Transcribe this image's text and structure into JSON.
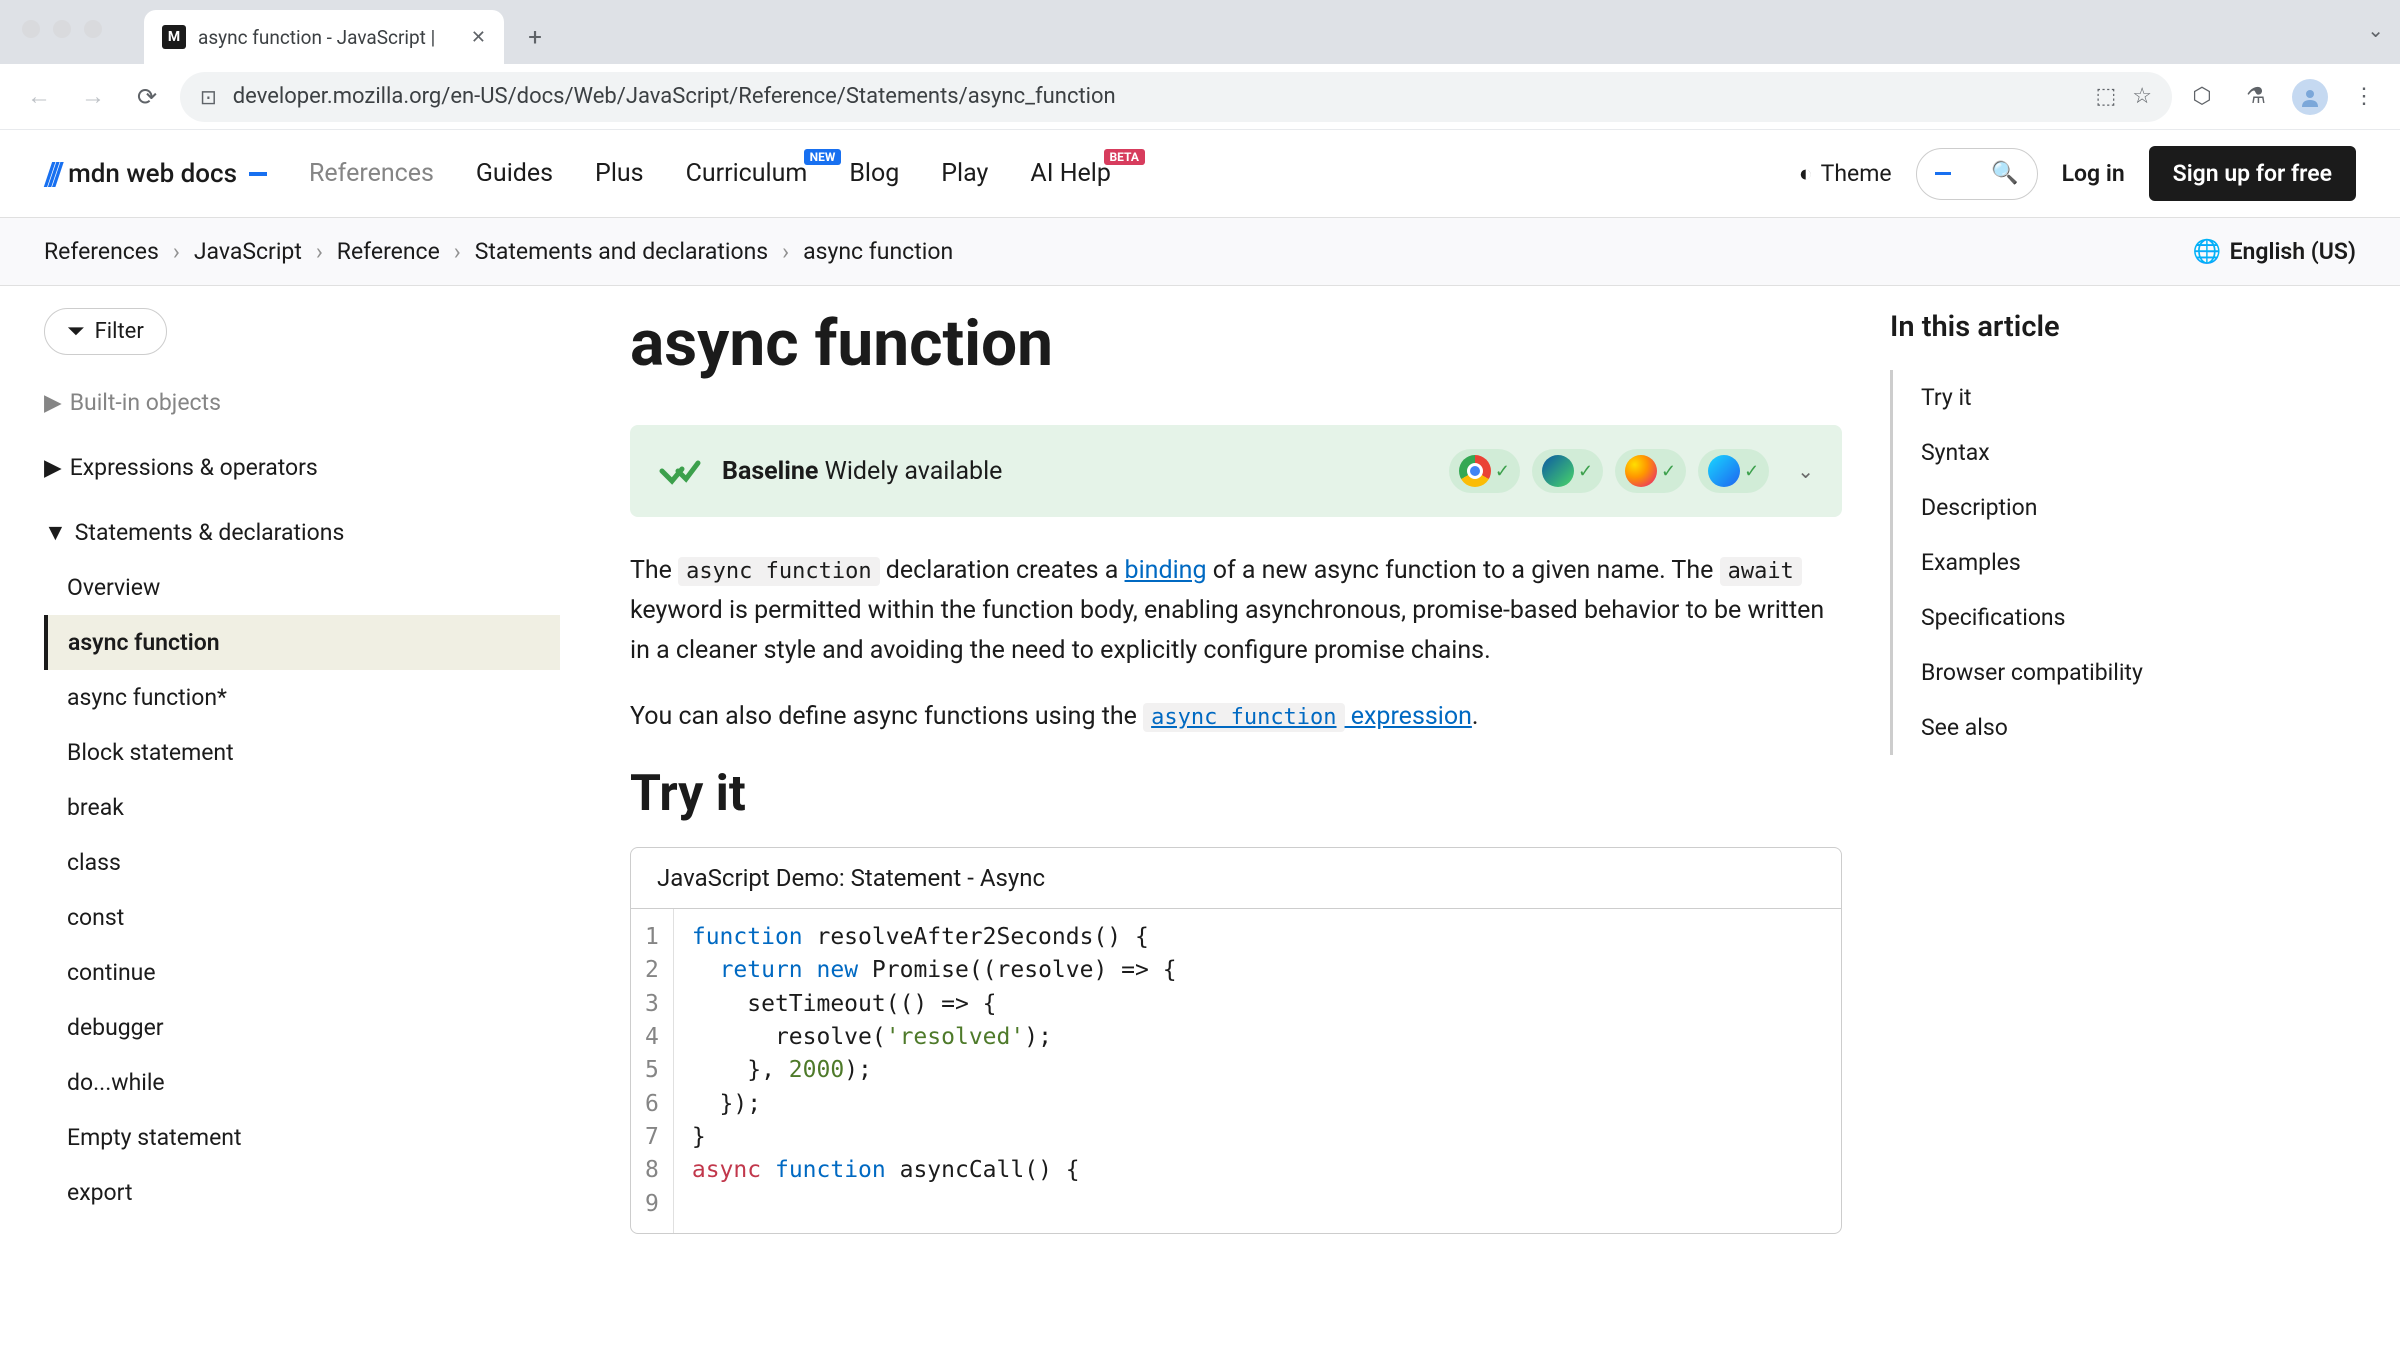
{
  "browser": {
    "tab_title": "async function - JavaScript |",
    "url": "developer.mozilla.org/en-US/docs/Web/JavaScript/Reference/Statements/async_function"
  },
  "header": {
    "logo_text": "mdn web docs",
    "nav": [
      {
        "label": "References",
        "active": true
      },
      {
        "label": "Guides"
      },
      {
        "label": "Plus"
      },
      {
        "label": "Curriculum",
        "badge": "NEW",
        "badge_class": "badge-new"
      },
      {
        "label": "Blog"
      },
      {
        "label": "Play"
      },
      {
        "label": "AI Help",
        "badge": "BETA",
        "badge_class": "badge-beta"
      }
    ],
    "theme_label": "Theme",
    "login_label": "Log in",
    "signup_label": "Sign up for free"
  },
  "breadcrumb": {
    "items": [
      "References",
      "JavaScript",
      "Reference",
      "Statements and declarations",
      "async function"
    ],
    "lang": "English (US)"
  },
  "sidebar": {
    "filter_label": "Filter",
    "sections": [
      {
        "label": "Built-in objects",
        "faded": true,
        "arrow": "▶"
      },
      {
        "label": "Expressions & operators",
        "arrow": "▶"
      },
      {
        "label": "Statements & declarations",
        "arrow": "▼",
        "items": [
          {
            "label": "Overview"
          },
          {
            "label": "async function",
            "active": true
          },
          {
            "label": "async function*"
          },
          {
            "label": "Block statement"
          },
          {
            "label": "break"
          },
          {
            "label": "class"
          },
          {
            "label": "const"
          },
          {
            "label": "continue"
          },
          {
            "label": "debugger"
          },
          {
            "label": "do...while"
          },
          {
            "label": "Empty statement"
          },
          {
            "label": "export"
          }
        ]
      }
    ]
  },
  "article": {
    "title": "async function",
    "baseline_strong": "Baseline",
    "baseline_rest": " Widely available",
    "intro_1_pre": "The ",
    "intro_1_code1": "async function",
    "intro_1_mid1": " declaration creates a ",
    "intro_1_link1": "binding",
    "intro_1_mid2": " of a new async function to a given name. The ",
    "intro_1_code2": "await",
    "intro_1_post": " keyword is permitted within the function body, enabling asynchronous, promise-based behavior to be written in a cleaner style and avoiding the need to explicitly configure promise chains.",
    "intro_2_pre": "You can also define async functions using the ",
    "intro_2_linkcode": "async function",
    "intro_2_linktext": " expression",
    "intro_2_post": ".",
    "tryit_heading": "Try it",
    "demo_title": "JavaScript Demo: Statement - Async",
    "code_lines": [
      [
        {
          "t": "function",
          "c": "tok-keyword"
        },
        {
          "t": " resolveAfter2Seconds() {"
        }
      ],
      [
        {
          "t": "  "
        },
        {
          "t": "return",
          "c": "tok-keyword"
        },
        {
          "t": " "
        },
        {
          "t": "new",
          "c": "tok-keyword"
        },
        {
          "t": " Promise((resolve) => {"
        }
      ],
      [
        {
          "t": "    setTimeout(() => {"
        }
      ],
      [
        {
          "t": "      resolve("
        },
        {
          "t": "'resolved'",
          "c": "tok-string"
        },
        {
          "t": ");"
        }
      ],
      [
        {
          "t": "    }, "
        },
        {
          "t": "2000",
          "c": "tok-number"
        },
        {
          "t": ");"
        }
      ],
      [
        {
          "t": "  });"
        }
      ],
      [
        {
          "t": "}"
        }
      ],
      [
        {
          "t": ""
        }
      ],
      [
        {
          "t": "async",
          "c": "tok-keyword2"
        },
        {
          "t": " "
        },
        {
          "t": "function",
          "c": "tok-keyword"
        },
        {
          "t": " asyncCall() {"
        }
      ]
    ]
  },
  "toc": {
    "heading": "In this article",
    "items": [
      "Try it",
      "Syntax",
      "Description",
      "Examples",
      "Specifications",
      "Browser compatibility",
      "See also"
    ]
  }
}
